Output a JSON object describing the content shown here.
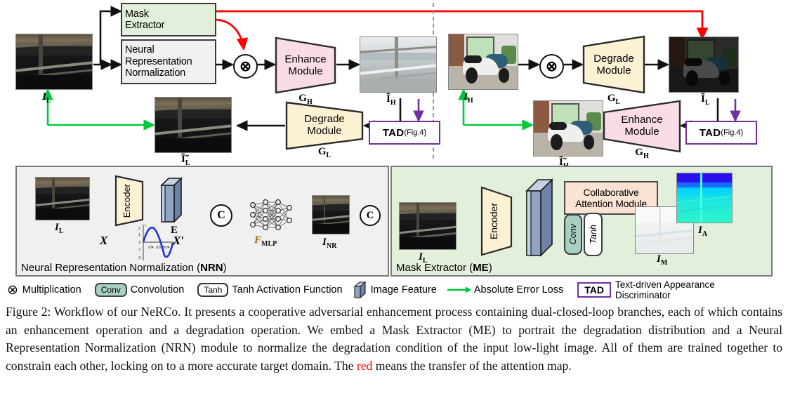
{
  "figure": {
    "label": "Figure 2:",
    "caption_html": "Figure 2: Workflow of our NeRCo. It presents a cooperative adversarial enhancement process containing dual-closed-loop branches, each of which contains an enhancement operation and a degradation operation. We embed a Mask Extractor (ME) to portrait the degradation distribution and a Neural Representation Normalization (NRN) module to normalize the degradation condition of the input low-light image. All of them are trained together to constrain each other, locking on to a more accurate target domain. The <span class=\"red\">red</span> means the transfer of the attention map."
  },
  "top_left_branch": {
    "input_label": "I L",
    "mask_extractor": {
      "line1": "Mask",
      "line2": "Extractor"
    },
    "nrn_box": {
      "line1": "Neural",
      "line2": "Representation",
      "line3": "Normalization"
    },
    "multiply_symbol": "⊗",
    "enhance_module": {
      "line1": "Enhance",
      "line2": "Module",
      "gen": "G",
      "gen_sub": "H"
    },
    "enhanced_label": "Ĩ H",
    "tad": {
      "text": "TAD",
      "ref": "(Fig.4)"
    },
    "degrade_module": {
      "line1": "Degrade",
      "line2": "Module",
      "gen": "G",
      "gen_sub": "L"
    },
    "recon_label": "Ĩ̃ L"
  },
  "top_right_branch": {
    "input_label": "I H",
    "multiply_symbol": "⊗",
    "degrade_module": {
      "line1": "Degrade",
      "line2": "Module",
      "gen": "G",
      "gen_sub": "L"
    },
    "degraded_label": "Ĩ L",
    "tad": {
      "text": "TAD",
      "ref": "(Fig.4)"
    },
    "enhance_module": {
      "line1": "Enhance",
      "line2": "Module",
      "gen": "G",
      "gen_sub": "H"
    },
    "recon_label": "Ĩ̃ H"
  },
  "nrn_panel": {
    "title_plain": "Neural Representation Normalization (",
    "title_bold": "NRN",
    "title_close": ")",
    "input_label": "I L",
    "encoder_label": "Encoder",
    "feature_label": "E",
    "x_label": "X",
    "x_prime_label": "X′",
    "concat_symbol": "C",
    "mlp_label": "F",
    "mlp_sub": "MLP",
    "output_label": "I NR",
    "sine_plot": {
      "type": "line",
      "title": "",
      "xlabel": "",
      "ylabel": "y",
      "yticks": [
        "2",
        "1",
        "0",
        "-1",
        "-2"
      ],
      "xticks": [
        "π/4",
        "π/2",
        "3π/4",
        "π"
      ],
      "ylim": [
        -2,
        2
      ],
      "xlim": [
        0,
        3.1416
      ],
      "series_name": "sin",
      "color": "#2030d0"
    }
  },
  "me_panel": {
    "title_plain": "Mask Extractor (",
    "title_bold": "ME",
    "title_close": ")",
    "input_label": "I L",
    "encoder_label": "Encoder",
    "cam": {
      "line1": "Collaborative",
      "line2": "Attention Module"
    },
    "conv_label": "Conv",
    "tanh_label": "Tanh",
    "mask_label": "I M",
    "attention_label": "I A"
  },
  "legend": {
    "items": [
      {
        "icon": "multiply-icon",
        "glyph": "⊗",
        "label": "Multiplication"
      },
      {
        "icon": "conv-chip",
        "chip": "Conv",
        "label": "Convolution"
      },
      {
        "icon": "tanh-chip",
        "chip": "Tanh",
        "label": "Tanh Activation Function"
      },
      {
        "icon": "feature-slab-icon",
        "label": "Image Feature"
      },
      {
        "icon": "green-arrow-icon",
        "label": "Absolute Error Loss"
      },
      {
        "icon": "tad-chip",
        "chip": "TAD",
        "label_line1": "Text-driven  Appearance",
        "label_line2": "Discriminator"
      }
    ]
  },
  "colors": {
    "green_panel": "#e2efda",
    "pink_module": "#fadce6",
    "cream_module": "#fdf1d4",
    "peach_box": "#fbe3d4",
    "teal_chip": "#a8cfc4",
    "attention_red": "#ff0000",
    "loss_green": "#00c83c",
    "tad_purple": "#7030a0",
    "feature_blue": "#8fa3c4",
    "gray_box": "#f0f0f0"
  }
}
